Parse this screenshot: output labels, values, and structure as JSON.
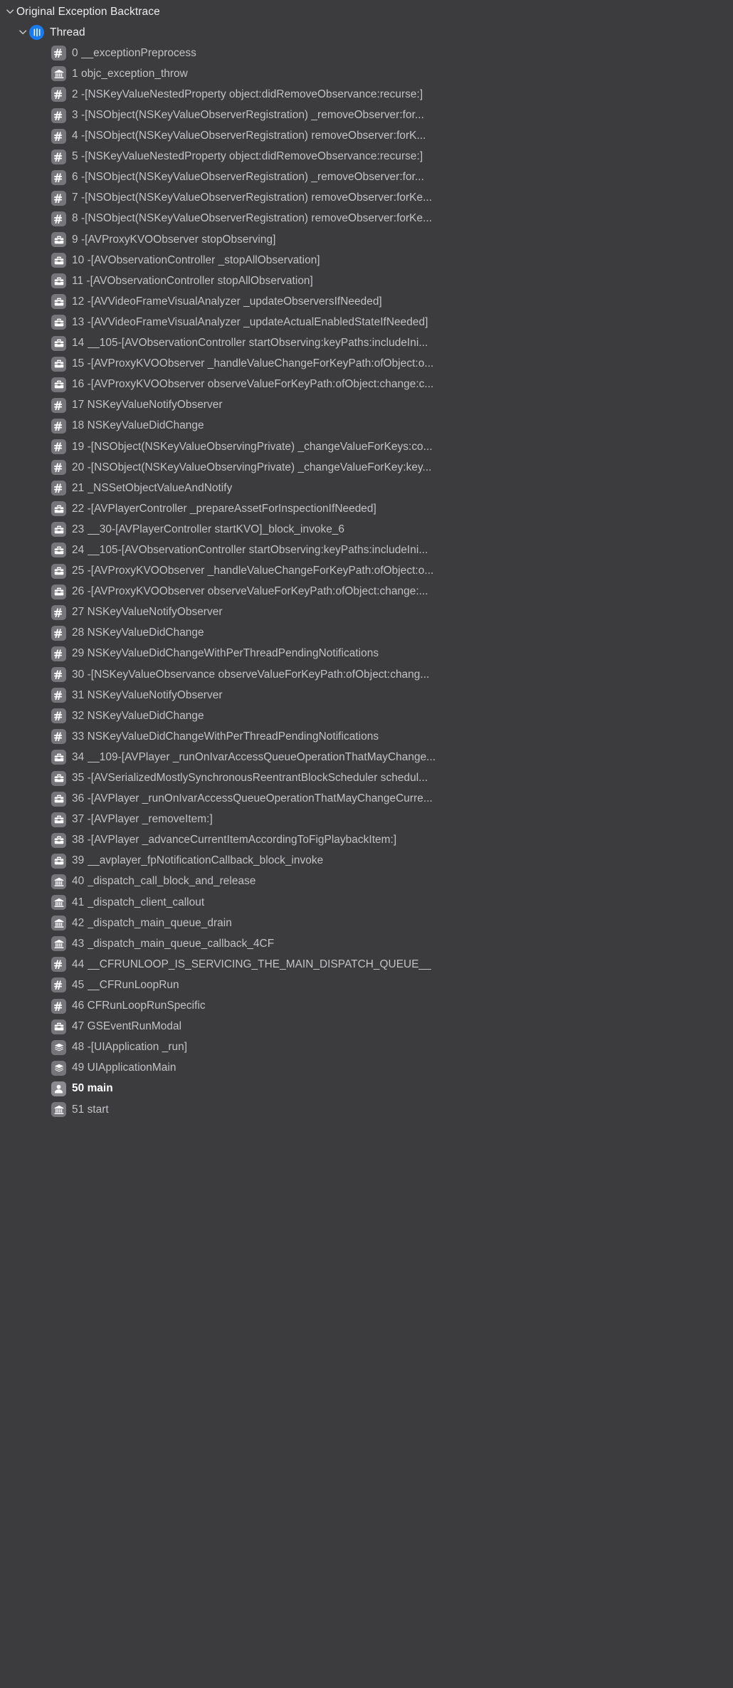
{
  "panel": {
    "title": "Original Exception Backtrace",
    "thread_label": "Thread",
    "icons": {
      "disclosure": "chevron-down-icon",
      "thread": "thread-icon",
      "framework": "hash-icon",
      "system": "bank-icon",
      "media": "toolbox-icon",
      "uikit": "layers-icon",
      "user": "person-icon"
    },
    "colors": {
      "background": "#3c3c3e",
      "thread_accent": "#197bf0",
      "icon_chip": "#76767a",
      "text": "#c3c3c6",
      "text_highlight": "#ffffff",
      "header_text": "#ededee"
    }
  },
  "frames": [
    {
      "index": "0",
      "symbol": "__exceptionPreprocess",
      "icon": "hash-icon",
      "user": false
    },
    {
      "index": "1",
      "symbol": "objc_exception_throw",
      "icon": "bank-icon",
      "user": false
    },
    {
      "index": "2",
      "symbol": "-[NSKeyValueNestedProperty object:didRemoveObservance:recurse:]",
      "icon": "hash-icon",
      "user": false
    },
    {
      "index": "3",
      "symbol": "-[NSObject(NSKeyValueObserverRegistration) _removeObserver:for...",
      "icon": "hash-icon",
      "user": false
    },
    {
      "index": "4",
      "symbol": "-[NSObject(NSKeyValueObserverRegistration) removeObserver:forK...",
      "icon": "hash-icon",
      "user": false
    },
    {
      "index": "5",
      "symbol": "-[NSKeyValueNestedProperty object:didRemoveObservance:recurse:]",
      "icon": "hash-icon",
      "user": false
    },
    {
      "index": "6",
      "symbol": "-[NSObject(NSKeyValueObserverRegistration) _removeObserver:for...",
      "icon": "hash-icon",
      "user": false
    },
    {
      "index": "7",
      "symbol": "-[NSObject(NSKeyValueObserverRegistration) removeObserver:forKe...",
      "icon": "hash-icon",
      "user": false
    },
    {
      "index": "8",
      "symbol": "-[NSObject(NSKeyValueObserverRegistration) removeObserver:forKe...",
      "icon": "hash-icon",
      "user": false
    },
    {
      "index": "9",
      "symbol": "-[AVProxyKVOObserver stopObserving]",
      "icon": "toolbox-icon",
      "user": false
    },
    {
      "index": "10",
      "symbol": "-[AVObservationController _stopAllObservation]",
      "icon": "toolbox-icon",
      "user": false
    },
    {
      "index": "11",
      "symbol": "-[AVObservationController stopAllObservation]",
      "icon": "toolbox-icon",
      "user": false
    },
    {
      "index": "12",
      "symbol": "-[AVVideoFrameVisualAnalyzer _updateObserversIfNeeded]",
      "icon": "toolbox-icon",
      "user": false
    },
    {
      "index": "13",
      "symbol": "-[AVVideoFrameVisualAnalyzer _updateActualEnabledStateIfNeeded]",
      "icon": "toolbox-icon",
      "user": false
    },
    {
      "index": "14",
      "symbol": "__105-[AVObservationController startObserving:keyPaths:includeIni...",
      "icon": "toolbox-icon",
      "user": false
    },
    {
      "index": "15",
      "symbol": "-[AVProxyKVOObserver _handleValueChangeForKeyPath:ofObject:o...",
      "icon": "toolbox-icon",
      "user": false
    },
    {
      "index": "16",
      "symbol": "-[AVProxyKVOObserver observeValueForKeyPath:ofObject:change:c...",
      "icon": "toolbox-icon",
      "user": false
    },
    {
      "index": "17",
      "symbol": "NSKeyValueNotifyObserver",
      "icon": "hash-icon",
      "user": false
    },
    {
      "index": "18",
      "symbol": "NSKeyValueDidChange",
      "icon": "hash-icon",
      "user": false
    },
    {
      "index": "19",
      "symbol": "-[NSObject(NSKeyValueObservingPrivate) _changeValueForKeys:co...",
      "icon": "hash-icon",
      "user": false
    },
    {
      "index": "20",
      "symbol": "-[NSObject(NSKeyValueObservingPrivate) _changeValueForKey:key...",
      "icon": "hash-icon",
      "user": false
    },
    {
      "index": "21",
      "symbol": "_NSSetObjectValueAndNotify",
      "icon": "hash-icon",
      "user": false
    },
    {
      "index": "22",
      "symbol": "-[AVPlayerController _prepareAssetForInspectionIfNeeded]",
      "icon": "toolbox-icon",
      "user": false
    },
    {
      "index": "23",
      "symbol": "__30-[AVPlayerController startKVO]_block_invoke_6",
      "icon": "toolbox-icon",
      "user": false
    },
    {
      "index": "24",
      "symbol": "__105-[AVObservationController startObserving:keyPaths:includeIni...",
      "icon": "toolbox-icon",
      "user": false
    },
    {
      "index": "25",
      "symbol": "-[AVProxyKVOObserver _handleValueChangeForKeyPath:ofObject:o...",
      "icon": "toolbox-icon",
      "user": false
    },
    {
      "index": "26",
      "symbol": "-[AVProxyKVOObserver observeValueForKeyPath:ofObject:change:...",
      "icon": "toolbox-icon",
      "user": false
    },
    {
      "index": "27",
      "symbol": "NSKeyValueNotifyObserver",
      "icon": "hash-icon",
      "user": false
    },
    {
      "index": "28",
      "symbol": "NSKeyValueDidChange",
      "icon": "hash-icon",
      "user": false
    },
    {
      "index": "29",
      "symbol": "NSKeyValueDidChangeWithPerThreadPendingNotifications",
      "icon": "hash-icon",
      "user": false
    },
    {
      "index": "30",
      "symbol": "-[NSKeyValueObservance observeValueForKeyPath:ofObject:chang...",
      "icon": "hash-icon",
      "user": false
    },
    {
      "index": "31",
      "symbol": "NSKeyValueNotifyObserver",
      "icon": "hash-icon",
      "user": false
    },
    {
      "index": "32",
      "symbol": "NSKeyValueDidChange",
      "icon": "hash-icon",
      "user": false
    },
    {
      "index": "33",
      "symbol": "NSKeyValueDidChangeWithPerThreadPendingNotifications",
      "icon": "hash-icon",
      "user": false
    },
    {
      "index": "34",
      "symbol": "__109-[AVPlayer _runOnIvarAccessQueueOperationThatMayChange...",
      "icon": "toolbox-icon",
      "user": false
    },
    {
      "index": "35",
      "symbol": "-[AVSerializedMostlySynchronousReentrantBlockScheduler schedul...",
      "icon": "toolbox-icon",
      "user": false
    },
    {
      "index": "36",
      "symbol": "-[AVPlayer _runOnIvarAccessQueueOperationThatMayChangeCurre...",
      "icon": "toolbox-icon",
      "user": false
    },
    {
      "index": "37",
      "symbol": "-[AVPlayer _removeItem:]",
      "icon": "toolbox-icon",
      "user": false
    },
    {
      "index": "38",
      "symbol": "-[AVPlayer _advanceCurrentItemAccordingToFigPlaybackItem:]",
      "icon": "toolbox-icon",
      "user": false
    },
    {
      "index": "39",
      "symbol": "__avplayer_fpNotificationCallback_block_invoke",
      "icon": "toolbox-icon",
      "user": false
    },
    {
      "index": "40",
      "symbol": "_dispatch_call_block_and_release",
      "icon": "bank-icon",
      "user": false
    },
    {
      "index": "41",
      "symbol": "_dispatch_client_callout",
      "icon": "bank-icon",
      "user": false
    },
    {
      "index": "42",
      "symbol": "_dispatch_main_queue_drain",
      "icon": "bank-icon",
      "user": false
    },
    {
      "index": "43",
      "symbol": "_dispatch_main_queue_callback_4CF",
      "icon": "bank-icon",
      "user": false
    },
    {
      "index": "44",
      "symbol": "__CFRUNLOOP_IS_SERVICING_THE_MAIN_DISPATCH_QUEUE__",
      "icon": "hash-icon",
      "user": false
    },
    {
      "index": "45",
      "symbol": "__CFRunLoopRun",
      "icon": "hash-icon",
      "user": false
    },
    {
      "index": "46",
      "symbol": "CFRunLoopRunSpecific",
      "icon": "hash-icon",
      "user": false
    },
    {
      "index": "47",
      "symbol": "GSEventRunModal",
      "icon": "toolbox-icon",
      "user": false
    },
    {
      "index": "48",
      "symbol": "-[UIApplication _run]",
      "icon": "layers-icon",
      "user": false
    },
    {
      "index": "49",
      "symbol": "UIApplicationMain",
      "icon": "layers-icon",
      "user": false
    },
    {
      "index": "50",
      "symbol": "main",
      "icon": "person-icon",
      "user": true
    },
    {
      "index": "51",
      "symbol": "start",
      "icon": "bank-icon",
      "user": false
    }
  ]
}
